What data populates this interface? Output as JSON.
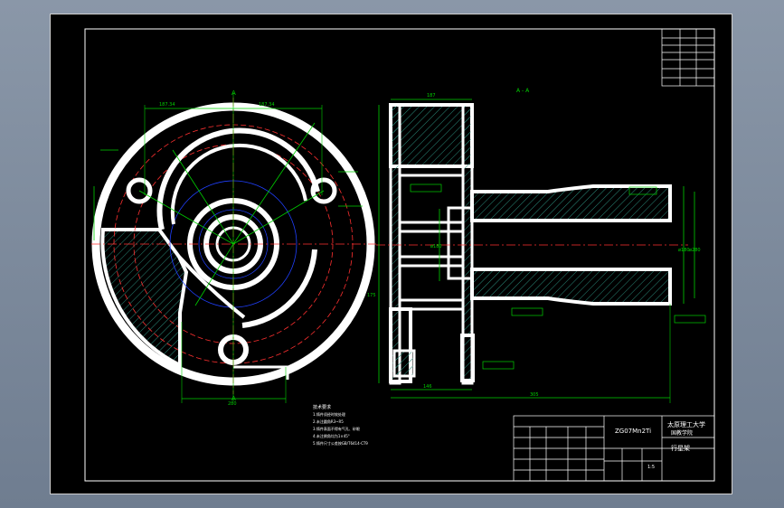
{
  "section_label": "A - A",
  "section_marks": [
    "A",
    "A"
  ],
  "material": "ZG07Mn2Ti",
  "company_line1": "太原理工大学",
  "company_line2": "国教学院",
  "part_name": "行星架",
  "scale": "1:5",
  "notes_title": "技术要求",
  "notes": [
    "1.铸件须经时效处理",
    "2.未注圆角R3~R5",
    "3.铸件表面不得有气孔、砂眼",
    "4.未注倒角均为1×45°",
    "5.铸件尺寸公差按GB/T6414-CT9"
  ],
  "dims_left": {
    "top_left": "187.34",
    "top_right": "187.34",
    "bottom": "280"
  },
  "dims_right": {
    "top": "187",
    "bottom_a": "146",
    "bottom_b": "305",
    "left_vert": "175",
    "bore": "ø180",
    "shaft": "ø180",
    "outer": "ø280"
  },
  "colors": {
    "background": "#000000",
    "outline": "#ffffff",
    "center_lines": "#ff3030",
    "dimension": "#00d000",
    "construction": "#2040ff",
    "hatch": "#2a8a7a"
  }
}
